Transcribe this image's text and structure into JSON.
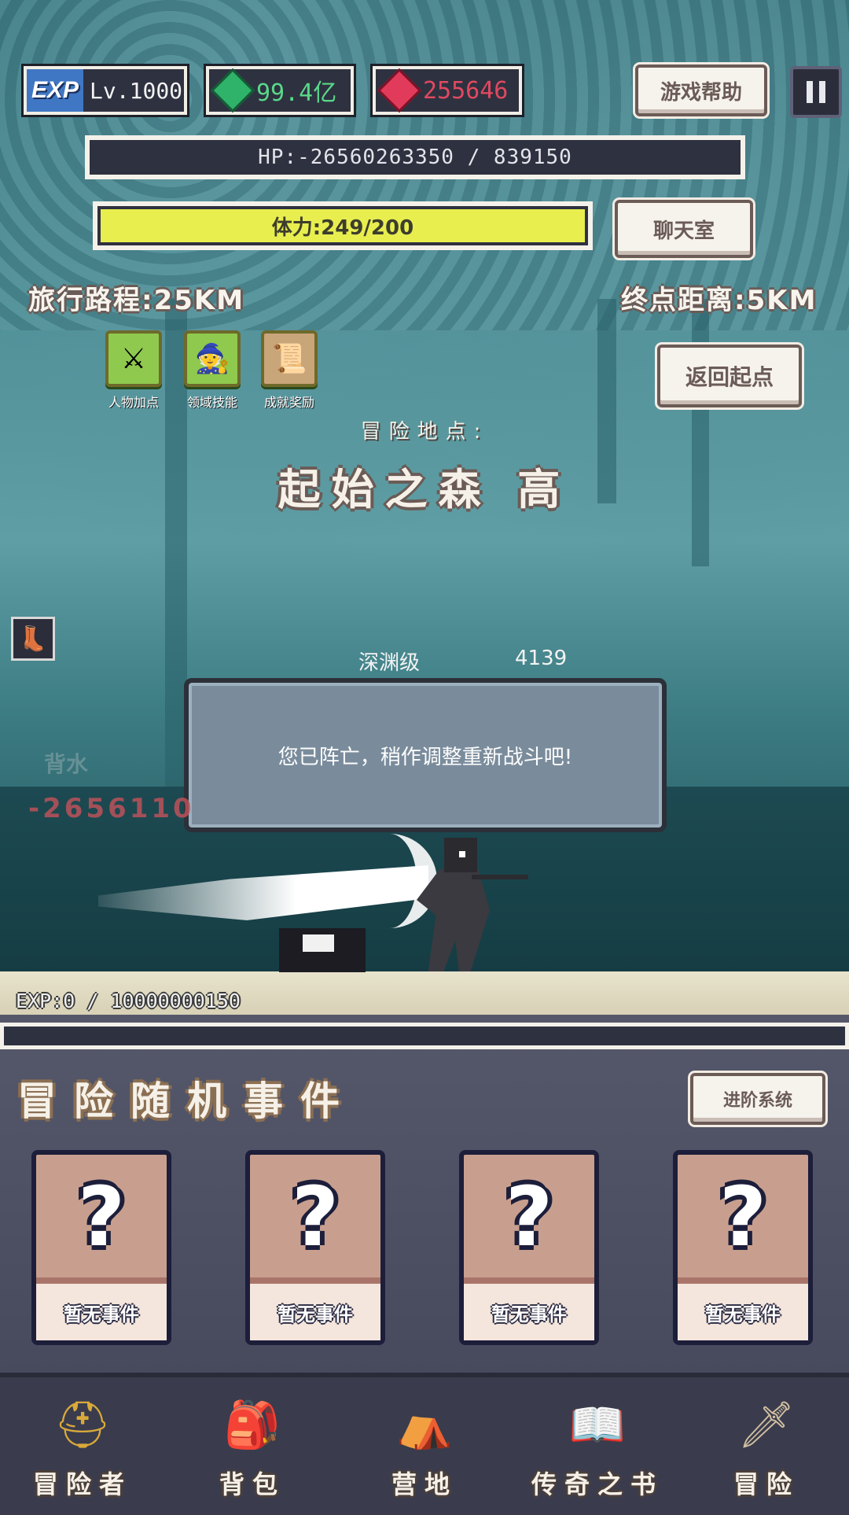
{
  "hud": {
    "exp_tag": "EXP",
    "level": "Lv.1000",
    "green_currency": "99.4亿",
    "red_currency": "255646",
    "help_button": "游戏帮助",
    "chat_button": "聊天室",
    "return_button": "返回起点",
    "hp_text": "HP:-26560263350 / 839150",
    "stamina_text": "体力:249/200",
    "stamina_fraction": 1.0,
    "travel_distance": "旅行路程:25KM",
    "remaining_distance": "终点距离:5KM"
  },
  "skills": [
    {
      "label": "人物加点",
      "icon": "crossed-swords-icon"
    },
    {
      "label": "领域技能",
      "icon": "mage-icon"
    },
    {
      "label": "成就奖励",
      "icon": "scroll-icon"
    }
  ],
  "location": {
    "label": "冒险地点:",
    "name": "起始之森 高"
  },
  "battle": {
    "monster_level": "深渊级",
    "monster_power": "4139",
    "dialog_message": "您已阵亡，稍作调整重新战斗吧!",
    "faint_damage": "背水",
    "damage_number": "-2656110"
  },
  "exp": {
    "text": "EXP:0 / 10000000150",
    "fraction": 0.0
  },
  "events": {
    "title": "冒险随机事件",
    "advance_button": "进阶系统",
    "cards": [
      {
        "symbol": "?",
        "label": "暂无事件"
      },
      {
        "symbol": "?",
        "label": "暂无事件"
      },
      {
        "symbol": "?",
        "label": "暂无事件"
      },
      {
        "symbol": "?",
        "label": "暂无事件"
      }
    ]
  },
  "nav": [
    {
      "label": "冒险者",
      "icon": "helmet-icon",
      "glyph": "⛑",
      "color": "#d9a93a"
    },
    {
      "label": "背包",
      "icon": "backpack-icon",
      "glyph": "🎒",
      "color": "#cfc6a6"
    },
    {
      "label": "营地",
      "icon": "camp-icon",
      "glyph": "⛺",
      "color": "#d8b548"
    },
    {
      "label": "传奇之书",
      "icon": "book-icon",
      "glyph": "📖",
      "color": "#c9b37a"
    },
    {
      "label": "冒险",
      "icon": "sword-icon",
      "glyph": "🗡",
      "color": "#d2c0a2"
    }
  ],
  "colors": {
    "stamina": "#e8ee4e",
    "hp_bar": "#2e3140",
    "damage": "#c5525a",
    "card": "#c89f8e"
  }
}
